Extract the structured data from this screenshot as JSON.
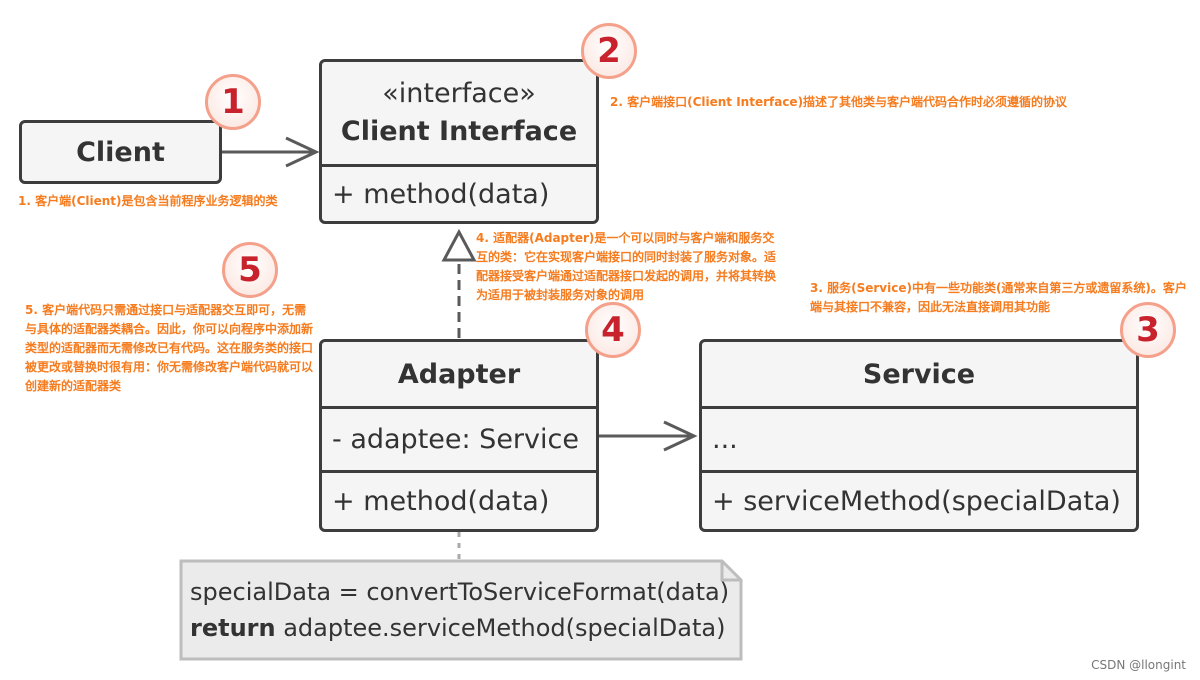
{
  "client": {
    "title": "Client"
  },
  "client_interface": {
    "stereotype": "«interface»",
    "title": "Client Interface",
    "method": "+ method(data)"
  },
  "adapter": {
    "title": "Adapter",
    "field": "- adaptee: Service",
    "method": "+ method(data)"
  },
  "service": {
    "title": "Service",
    "field": "...",
    "method": "+ serviceMethod(specialData)"
  },
  "code_note": {
    "line1": "specialData = convertToServiceFormat(data)",
    "line2_keyword": "return",
    "line2_rest": " adaptee.serviceMethod(specialData)"
  },
  "badges": [
    "1",
    "2",
    "3",
    "4",
    "5"
  ],
  "notes": {
    "n1": "1. 客户端(Client)是包含当前程序业务逻辑的类",
    "n2": "2. 客户端接口(Client Interface)描述了其他类与客户端代码合作时必须遵循的协议",
    "n3": "3. 服务(Service)中有一些功能类(通常来自第三方或遗留系统)。客户端与其接口不兼容，因此无法直接调用其功能",
    "n4": "4. 适配器(Adapter)是一个可以同时与客户端和服务交互的类：它在实现客户端接口的同时封装了服务对象。适配器接受客户端通过适配器接口发起的调用，并将其转换为适用于被封装服务对象的调用",
    "n5": "5. 客户端代码只需通过接口与适配器交互即可，无需与具体的适配器类耦合。因此，你可以向程序中添加新类型的适配器而无需修改已有代码。这在服务类的接口被更改或替换时很有用：你无需修改客户端代码就可以创建新的适配器类"
  },
  "watermark": "CSDN @llongint",
  "colors": {
    "note_text": "#f57c1f",
    "badge_number": "#c8232c",
    "badge_ring": "#f4a08a",
    "box_border": "#3d3d3d",
    "box_fill": "#f5f5f5"
  }
}
